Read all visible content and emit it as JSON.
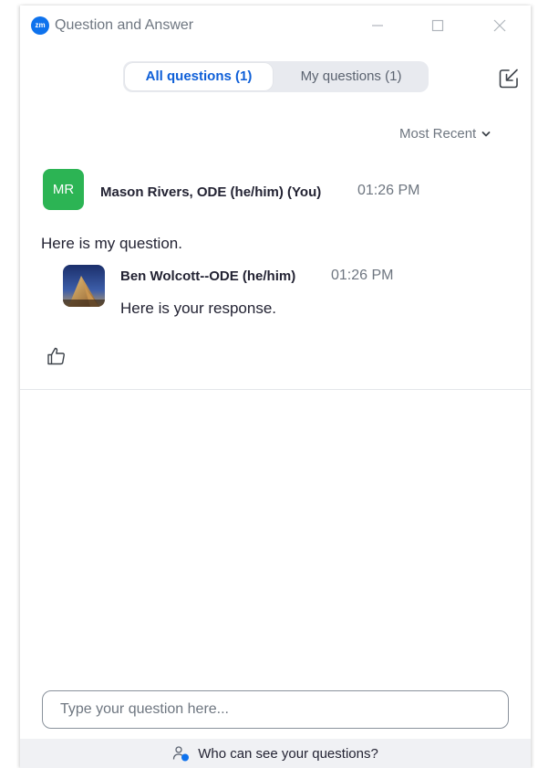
{
  "window": {
    "logo_text": "zm",
    "title": "Question and Answer"
  },
  "tabs": [
    {
      "label": "All questions (1)",
      "active": true
    },
    {
      "label": "My questions (1)",
      "active": false
    }
  ],
  "sort": {
    "label": "Most Recent"
  },
  "question": {
    "avatar_initials": "MR",
    "author": "Mason Rivers, ODE (he/him) (You)",
    "time": "01:26 PM",
    "text": "Here is my question."
  },
  "response": {
    "author": "Ben Wolcott--ODE (he/him)",
    "time": "01:26 PM",
    "text": "Here is your response."
  },
  "input": {
    "placeholder": "Type your question here..."
  },
  "footer": {
    "label": "Who can see your questions?"
  },
  "colors": {
    "accent": "#0e5fd8",
    "zoom_blue": "#0e72ed",
    "avatar_green": "#2cb454"
  },
  "icons": [
    "minimize-icon",
    "maximize-icon",
    "close-icon",
    "popout-icon",
    "chevron-down-icon",
    "thumbs-up-icon",
    "people-icon"
  ]
}
